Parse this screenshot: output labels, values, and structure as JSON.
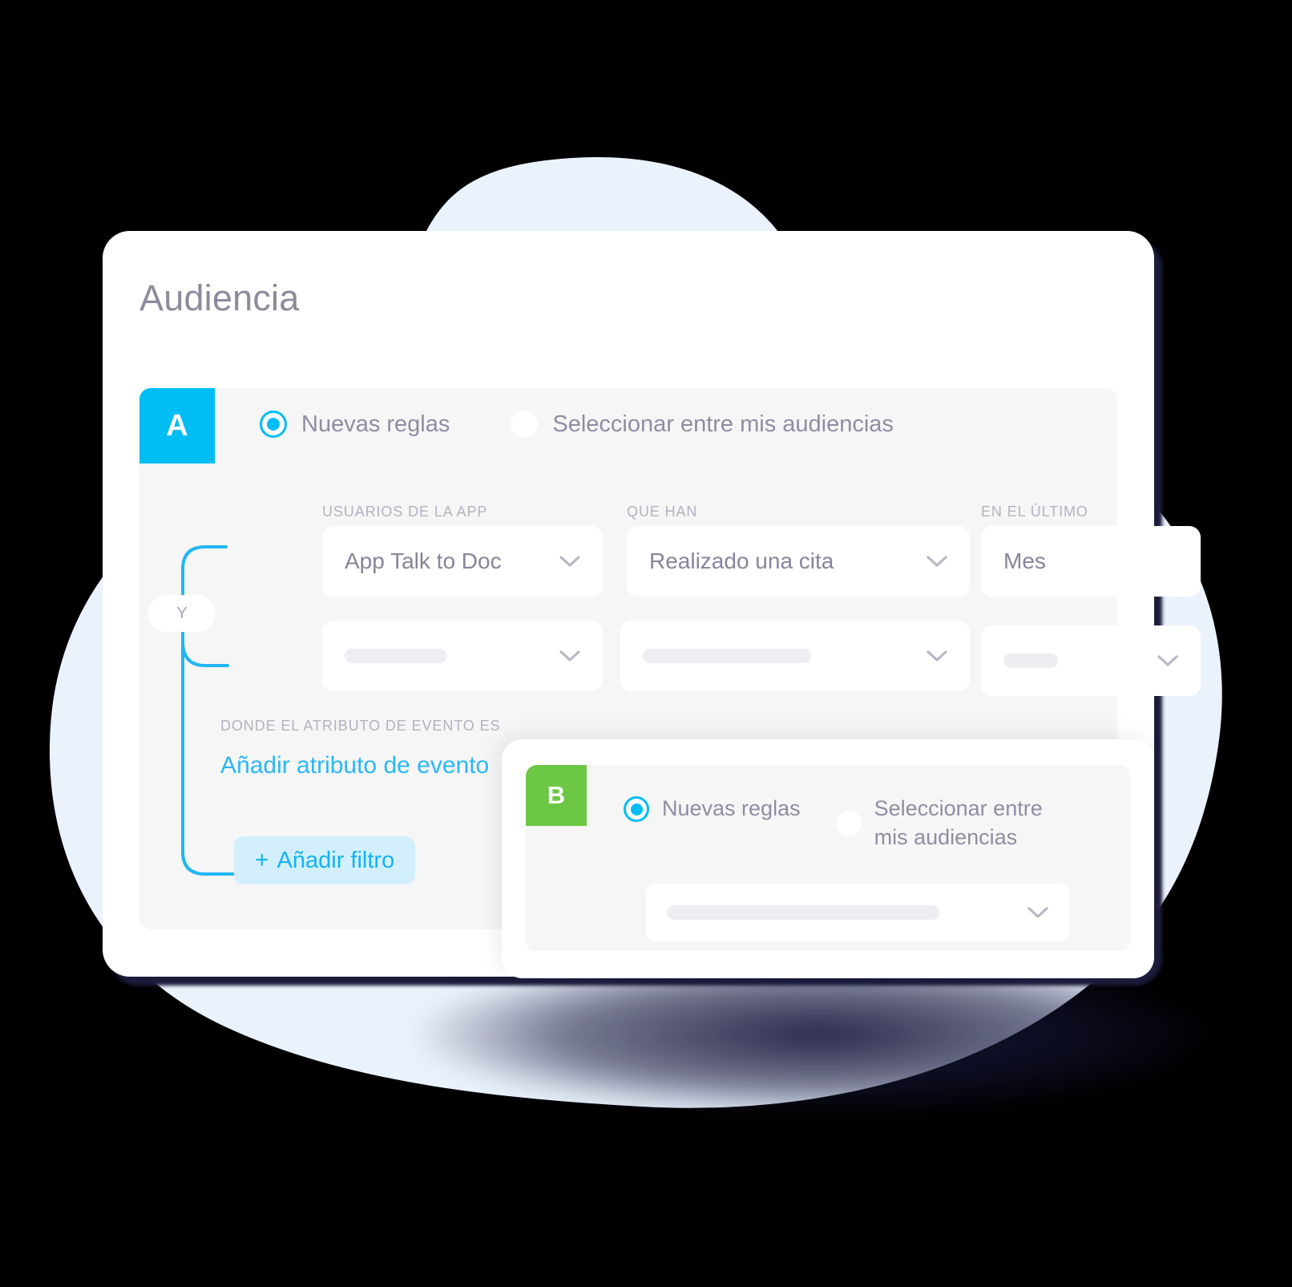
{
  "page": {
    "title": "Audiencia"
  },
  "colors": {
    "accent_cyan": "#00bdf4",
    "accent_green": "#6cc844",
    "link_blue": "#2bb7f5",
    "text_muted": "#8e8ea3",
    "label_muted": "#b2b2c2",
    "panel_bg": "#f6f6f6",
    "card_bg": "#ffffff",
    "blob_blue": "#eaf2fc",
    "shadow_navy": "#1b1b3a",
    "add_filter_bg": "#d3effd"
  },
  "panel_a": {
    "badge": "A",
    "radio_options": [
      {
        "label": "Nuevas reglas",
        "selected": true
      },
      {
        "label": "Seleccionar entre mis audiencias",
        "selected": false
      }
    ],
    "columns": [
      {
        "label": "Usuarios de la app"
      },
      {
        "label": "Que han"
      },
      {
        "label": "En el último"
      }
    ],
    "row1": [
      {
        "value": "App Talk to Doc",
        "has_chevron": true
      },
      {
        "value": "Realizado una cita",
        "has_chevron": true
      },
      {
        "value": "Mes",
        "has_chevron": false
      }
    ],
    "row2": [
      {
        "value": "",
        "placeholder_width": 128,
        "has_chevron": true
      },
      {
        "value": "",
        "placeholder_width": 210,
        "has_chevron": true
      },
      {
        "value": "",
        "placeholder_width": 68,
        "has_chevron": true
      }
    ],
    "connector_label": "Y",
    "attribute_label": "Donde el atributo de evento es",
    "attribute_link": "Añadir atributo de evento",
    "add_filter": {
      "plus": "+",
      "label": "Añadir filtro"
    }
  },
  "panel_b": {
    "badge": "B",
    "radio_options": [
      {
        "label": "Nuevas reglas",
        "selected": true
      },
      {
        "label": "Seleccionar entre mis audiencias",
        "selected": false
      }
    ],
    "field": {
      "value": "",
      "placeholder_width": 340,
      "has_chevron": true
    }
  }
}
